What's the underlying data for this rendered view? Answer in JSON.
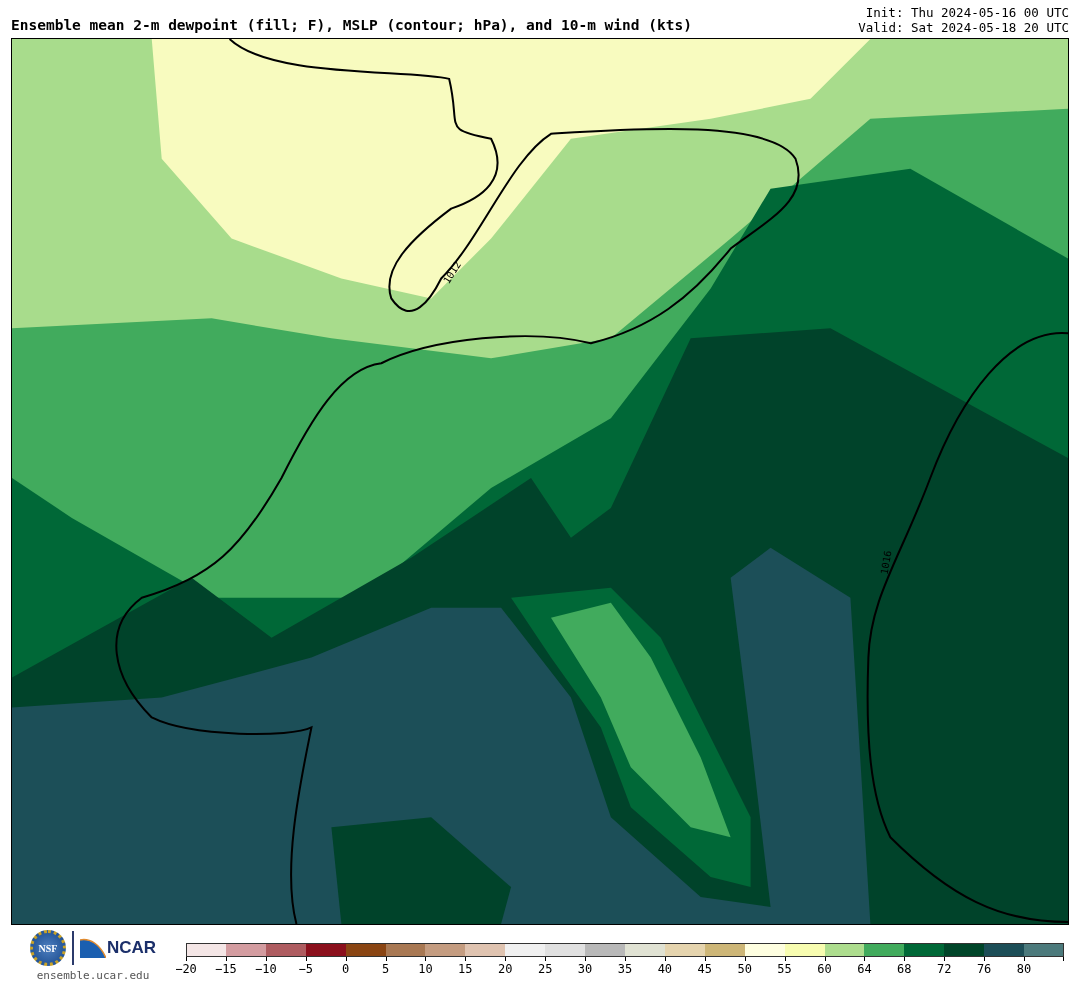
{
  "title": "Ensemble mean 2-m dewpoint (fill; F), MSLP (contour; hPa), and 10-m wind (kts)",
  "run_info": [
    "Init: Thu 2024-05-16 00 UTC",
    "Valid: Sat 2024-05-18 20 UTC"
  ],
  "map": {
    "contour_labels": [
      "1012",
      "1016"
    ]
  },
  "logos": {
    "nsf": "NSF",
    "ncar": "NCAR",
    "site": "ensemble.ucar.edu"
  },
  "colorbar": {
    "bins": [
      {
        "label": "−20",
        "color": "#f4e6e6"
      },
      {
        "label": "−15",
        "color": "#d39ca0"
      },
      {
        "label": "−10",
        "color": "#ae5c60"
      },
      {
        "label": "−5",
        "color": "#8b101d"
      },
      {
        "label": "0",
        "color": "#8a4513"
      },
      {
        "label": "5",
        "color": "#a87853"
      },
      {
        "label": "10",
        "color": "#c49c80"
      },
      {
        "label": "15",
        "color": "#dfc3b0"
      },
      {
        "label": "20",
        "color": "#f0f0f0"
      },
      {
        "label": "25",
        "color": "#e0e0e0"
      },
      {
        "label": "30",
        "color": "#b8b8b8"
      },
      {
        "label": "35",
        "color": "#e0e2d3"
      },
      {
        "label": "40",
        "color": "#e5d4ae"
      },
      {
        "label": "45",
        "color": "#cdb677"
      },
      {
        "label": "50",
        "color": "#fefee0"
      },
      {
        "label": "55",
        "color": "#f7fcb0"
      },
      {
        "label": "60",
        "color": "#addd8e"
      },
      {
        "label": "64",
        "color": "#41ab5d"
      },
      {
        "label": "68",
        "color": "#006837"
      },
      {
        "label": "72",
        "color": "#004529"
      },
      {
        "label": "76",
        "color": "#1d4e57"
      },
      {
        "label": "80",
        "color": "#4c7a7c"
      }
    ]
  }
}
